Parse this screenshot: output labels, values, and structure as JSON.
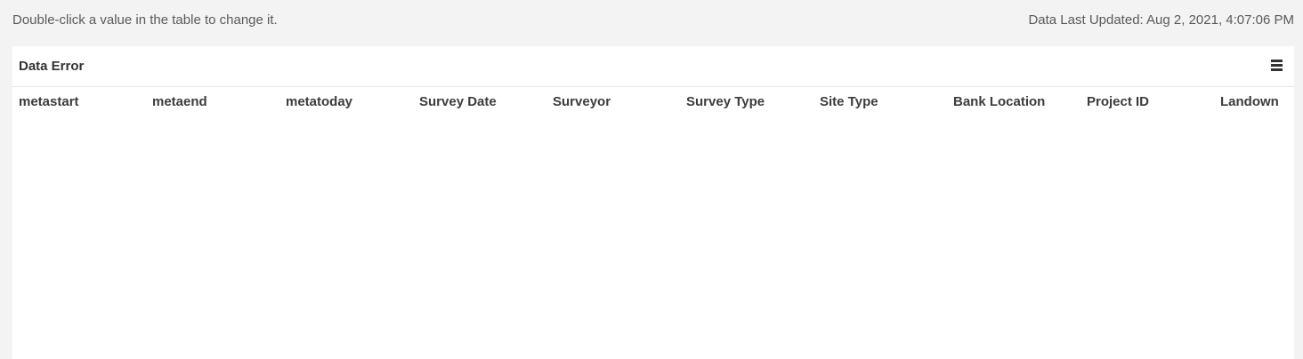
{
  "top_bar": {
    "hint": "Double-click a value in the table to change it.",
    "last_updated": "Data Last Updated: Aug 2, 2021, 4:07:06 PM"
  },
  "panel": {
    "title": "Data Error",
    "menu_icon": "hamburger-menu-icon"
  },
  "table": {
    "columns": [
      "metastart",
      "metaend",
      "metatoday",
      "Survey Date",
      "Surveyor",
      "Survey Type",
      "Site Type",
      "Bank Location",
      "Project ID",
      "Landown"
    ],
    "rows": []
  }
}
